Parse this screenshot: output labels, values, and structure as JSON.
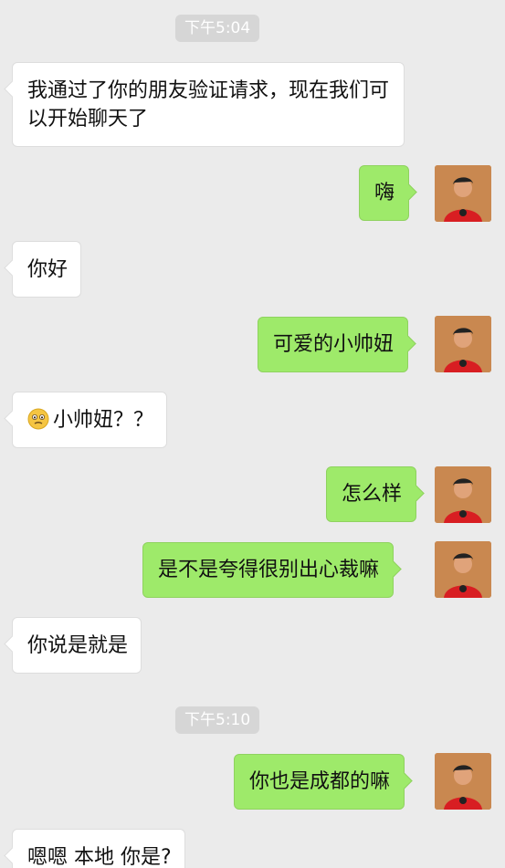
{
  "timestamps": [
    "下午5:04",
    "下午5:10"
  ],
  "messages": [
    {
      "side": "in",
      "text": "我通过了你的朋友验证请求，现在我们可以开始聊天了"
    },
    {
      "side": "out",
      "text": "嗨"
    },
    {
      "side": "in",
      "text": "你好"
    },
    {
      "side": "out",
      "text": "可爱的小帅妞"
    },
    {
      "side": "in",
      "text": "小帅妞？？",
      "icon": "worried-face-emoji-icon"
    },
    {
      "side": "out",
      "text": "怎么样"
    },
    {
      "side": "out",
      "text": "是不是夸得很别出心裁嘛"
    },
    {
      "side": "in",
      "text": "你说是就是"
    },
    {
      "side": "out",
      "text": "你也是成都的嘛"
    },
    {
      "side": "in",
      "text": "嗯嗯 本地 你是?"
    }
  ],
  "colors": {
    "background": "#ebebeb",
    "incoming_bubble": "#ffffff",
    "outgoing_bubble": "#9eea6a",
    "timestamp_pill": "#d6d6d6",
    "avatar_shirt": "#d81e22"
  }
}
